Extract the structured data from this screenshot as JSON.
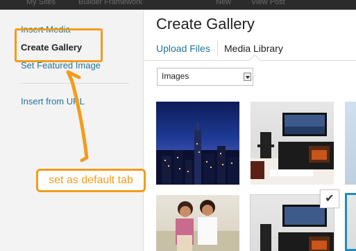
{
  "admin_bar": {
    "items": [
      "My Sites",
      "Builder Framework",
      "New",
      "View Post"
    ]
  },
  "sidebar": {
    "items": [
      {
        "label": "Insert Media",
        "active": false
      },
      {
        "label": "Create Gallery",
        "active": true
      },
      {
        "label": "Set Featured Image",
        "active": false
      },
      {
        "label": "Insert from URL",
        "active": false
      }
    ]
  },
  "main": {
    "title": "Create Gallery",
    "tabs": [
      {
        "label": "Upload Files",
        "active": false
      },
      {
        "label": "Media Library",
        "active": true
      }
    ],
    "filter": {
      "selected": "Images"
    },
    "thumbnails": [
      {
        "subject": "city-skyline-night"
      },
      {
        "subject": "living-room-tv-stand"
      },
      {
        "subject": "partial-thumbnail"
      },
      {
        "subject": "couple-on-sofa"
      },
      {
        "subject": "living-room-tv-stand",
        "selected": true
      },
      {
        "subject": "partial-thumbnail",
        "selected": true
      }
    ],
    "checkbox_glyph": "✔"
  },
  "annotation": {
    "callout": "set as default tab",
    "color": "#f39c1c"
  },
  "colors": {
    "link": "#21759b",
    "selection": "#1e8cbe",
    "accent": "#f39c1c"
  }
}
